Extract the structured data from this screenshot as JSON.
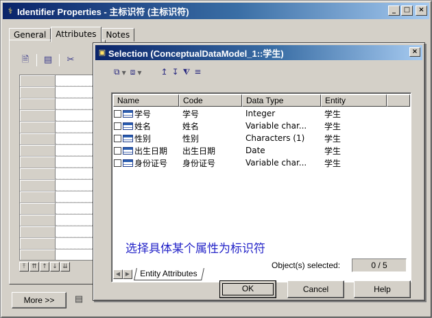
{
  "window": {
    "title": "Identifier Properties - 主标识符 (主标识符)",
    "icon": "identifier-key-icon",
    "controls": {
      "minimize": "_",
      "maximize": "□",
      "close": "×"
    }
  },
  "tabs": [
    {
      "label": "General"
    },
    {
      "label": "Attributes"
    },
    {
      "label": "Notes"
    }
  ],
  "active_tab": "Attributes",
  "left_panel": {
    "toolbar_icons": [
      "properties-icon",
      "add-attributes-icon",
      "cut-icon"
    ],
    "arrow_buttons": [
      "move-top",
      "move-up-page",
      "move-up",
      "move-down",
      "move-down-page"
    ]
  },
  "buttons": {
    "more": "More >>"
  },
  "selection_dialog": {
    "title": "Selection (ConceptualDataModel_1::学生)",
    "close": "×",
    "toolbar_icons": [
      "select-all-icon",
      "deselect-all-icon",
      "move-to-top-icon",
      "move-to-bottom-icon",
      "filter-icon",
      "filter-list-icon"
    ],
    "columns": [
      "Name",
      "Code",
      "Data Type",
      "Entity"
    ],
    "rows": [
      {
        "name": "学号",
        "code": "学号",
        "data_type": "Integer",
        "entity": "学生",
        "checked": false
      },
      {
        "name": "姓名",
        "code": "姓名",
        "data_type": "Variable char...",
        "entity": "学生",
        "checked": false
      },
      {
        "name": "性别",
        "code": "性别",
        "data_type": "Characters (1)",
        "entity": "学生",
        "checked": false
      },
      {
        "name": "出生日期",
        "code": "出生日期",
        "data_type": "Date",
        "entity": "学生",
        "checked": false
      },
      {
        "name": "身份证号",
        "code": "身份证号",
        "data_type": "Variable char...",
        "entity": "学生",
        "checked": false
      }
    ],
    "annotation": "选择具体某个属性为标识符",
    "sheet_tab": "Entity Attributes",
    "status_label": "Object(s) selected:",
    "status_value": "0 / 5",
    "ok": "OK",
    "cancel": "Cancel",
    "help": "Help"
  }
}
